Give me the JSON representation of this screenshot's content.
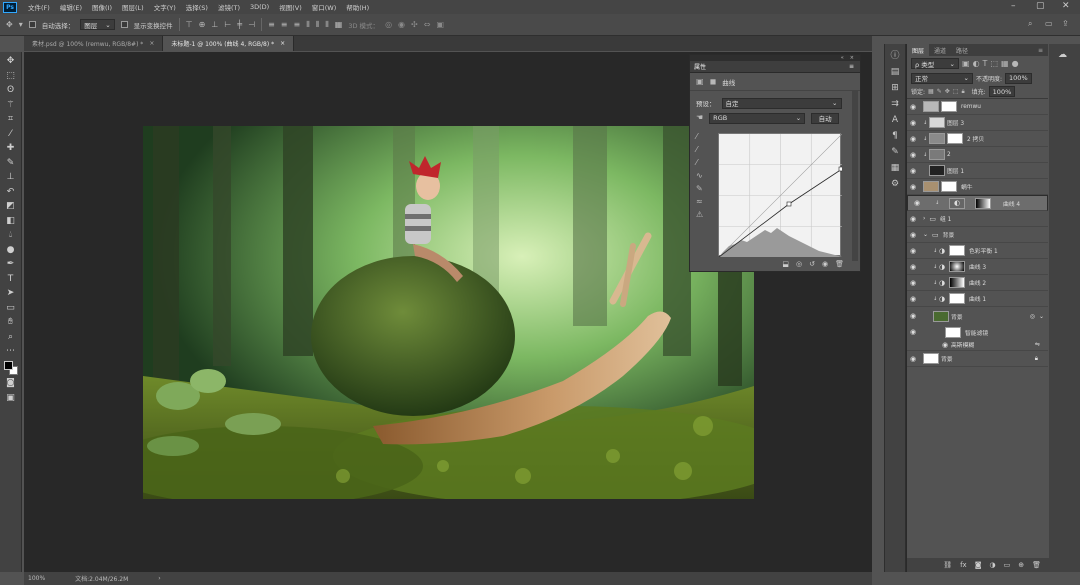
{
  "menubar": {
    "logo": "Ps",
    "items": [
      "文件(F)",
      "编辑(E)",
      "图像(I)",
      "图层(L)",
      "文字(Y)",
      "选择(S)",
      "滤镜(T)",
      "3D(D)",
      "视图(V)",
      "窗口(W)",
      "帮助(H)"
    ]
  },
  "options": {
    "auto_select_label": "自动选择：",
    "auto_select_value": "图层",
    "transform_label": "显示变换控件",
    "mode_3d_label": "3D 模式："
  },
  "tabs": [
    {
      "label": "素材.psd @ 100% (remwu, RGB/8#) *",
      "close": "×"
    },
    {
      "label": "未标题-1 @ 100% (曲线 4, RGB/8) *",
      "close": "×"
    }
  ],
  "status": {
    "zoom": "100%",
    "doc": "文档:2.04M/26.2M"
  },
  "properties": {
    "panel_title": "属性",
    "adjustment_title": "曲线",
    "preset_label": "预设：",
    "preset_value": "自定",
    "channel_value": "RGB",
    "auto_label": "自动"
  },
  "layers_panel": {
    "tabs": [
      "图层",
      "通道",
      "路径"
    ],
    "filter_value": "ρ 类型",
    "blend_mode": "正常",
    "opacity_label": "不透明度:",
    "opacity_value": "100%",
    "lock_label": "锁定:",
    "fill_label": "填充:",
    "fill_value": "100%",
    "rows": [
      {
        "name": "remwu",
        "selected": false,
        "indent": 0
      },
      {
        "name": "图层 3",
        "selected": false,
        "indent": 0
      },
      {
        "name": "2 拷贝",
        "selected": false,
        "indent": 0
      },
      {
        "name": "2",
        "selected": false,
        "indent": 0
      },
      {
        "name": "图层 1",
        "selected": false,
        "indent": 0
      },
      {
        "name": "蜗牛",
        "selected": false,
        "indent": 0
      },
      {
        "name": "曲线 4",
        "selected": true,
        "indent": 0
      },
      {
        "name": "组 1",
        "selected": false,
        "indent": 0
      },
      {
        "name": "背景",
        "selected": false,
        "indent": 0
      },
      {
        "name": "色彩平衡 1",
        "selected": false,
        "indent": 1
      },
      {
        "name": "曲线 3",
        "selected": false,
        "indent": 1
      },
      {
        "name": "曲线 2",
        "selected": false,
        "indent": 1
      },
      {
        "name": "曲线 1",
        "selected": false,
        "indent": 1
      },
      {
        "name": "背景",
        "selected": false,
        "indent": 1
      },
      {
        "name": "智能滤镜",
        "selected": false,
        "indent": 2
      },
      {
        "name": "高斯模糊",
        "selected": false,
        "indent": 3
      },
      {
        "name": "背景",
        "selected": false,
        "indent": 0
      }
    ]
  },
  "colors": {
    "accent": "#31a8ff",
    "panel": "#535353",
    "canvas_bg": "#282828"
  }
}
